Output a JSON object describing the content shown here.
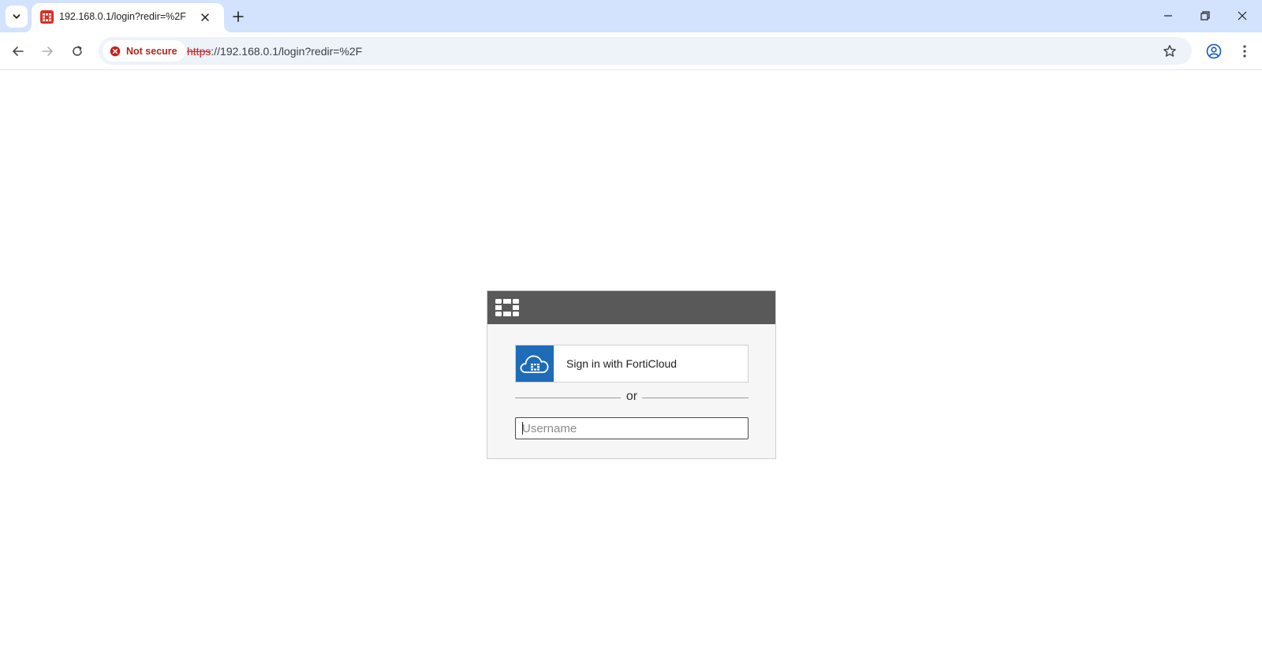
{
  "browser": {
    "tab_title": "192.168.0.1/login?redir=%2F",
    "security_label": "Not secure",
    "url_scheme": "https",
    "url_rest": "://192.168.0.1/login?redir=%2F",
    "colors": {
      "tabstrip": "#d3e3fd",
      "omnibox": "#eef2f9",
      "insecure": "#b3261e"
    }
  },
  "login": {
    "forticloud_label": "Sign in with FortiCloud",
    "or_label": "or",
    "username_placeholder": "Username",
    "username_value": "",
    "colors": {
      "header": "#595959",
      "forticloud_blue": "#1e6bb8"
    }
  }
}
